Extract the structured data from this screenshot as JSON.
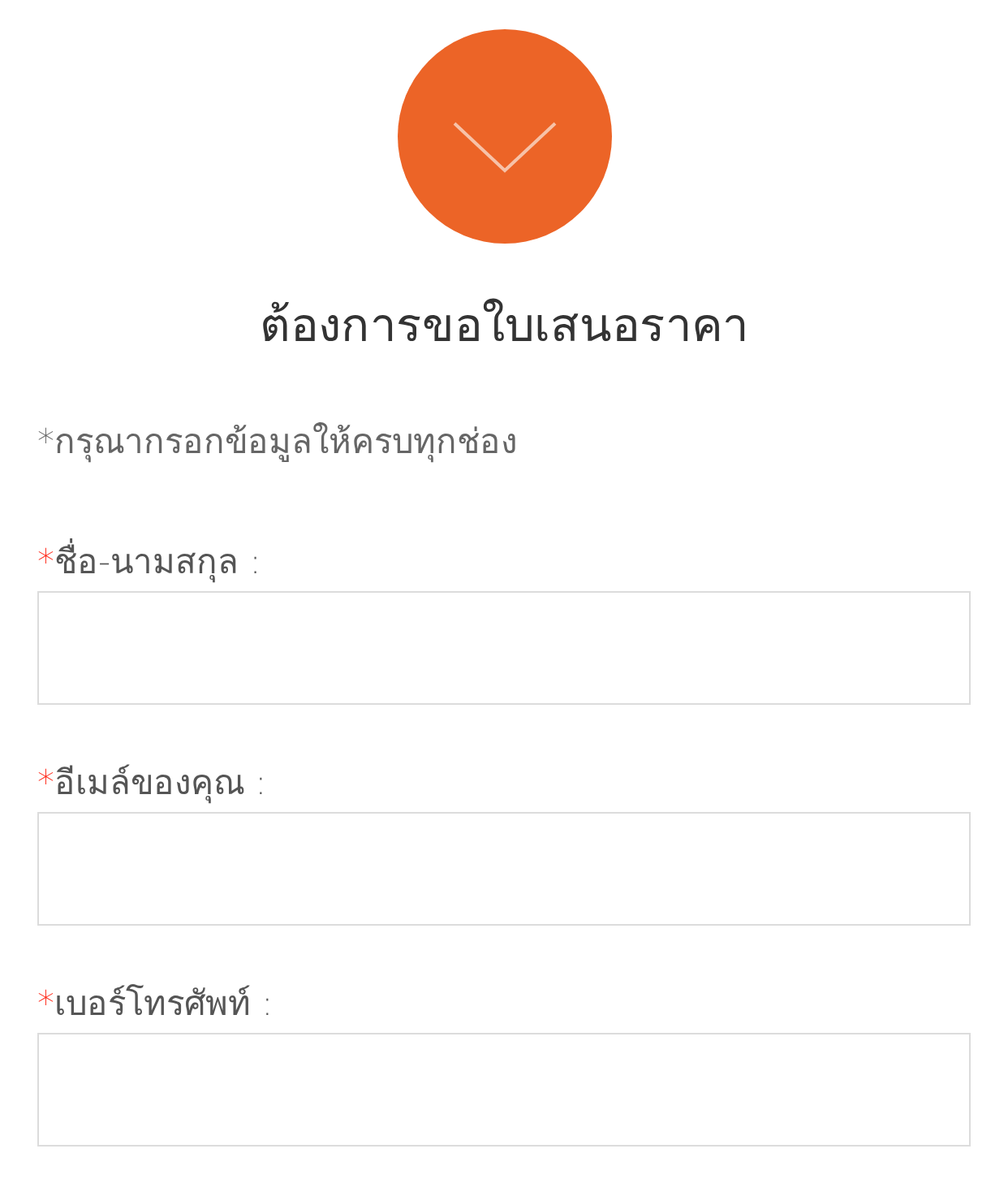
{
  "header": {
    "title": "ต้องการขอใบเสนอราคา"
  },
  "note": "*กรุณากรอกข้อมูลให้ครบทุกช่อง",
  "required_mark": "*",
  "fields": [
    {
      "label": "ชื่อ-นามสกุล :",
      "required": true
    },
    {
      "label": "อีเมล์ของคุณ :",
      "required": true
    },
    {
      "label": "เบอร์โทรศัพท์ :",
      "required": true
    }
  ]
}
